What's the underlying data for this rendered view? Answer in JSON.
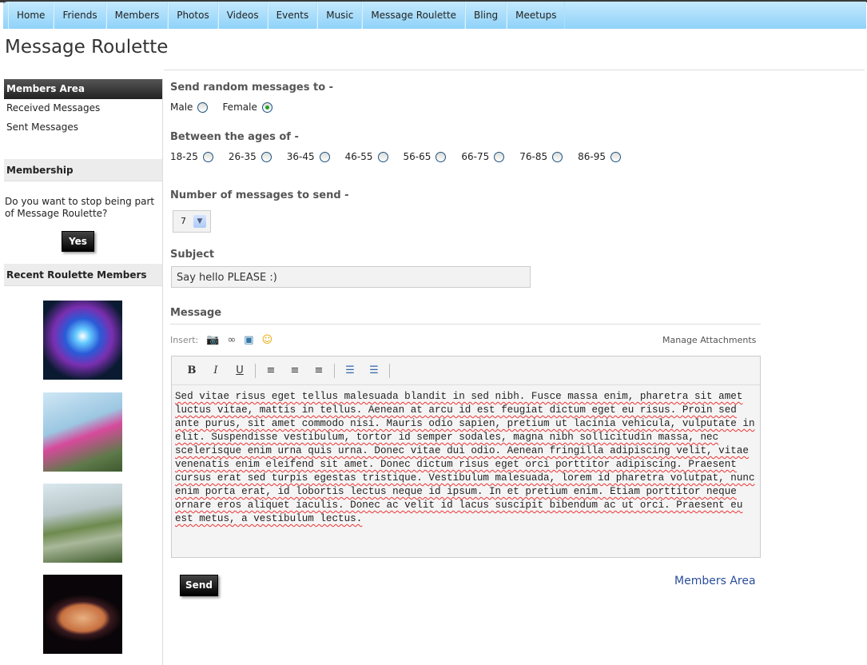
{
  "nav": {
    "items": [
      "Home",
      "Friends",
      "Members",
      "Photos",
      "Videos",
      "Events",
      "Music",
      "Message Roulette",
      "Bling",
      "Meetups"
    ]
  },
  "page_title": "Message Roulette",
  "sidebar": {
    "members_area": {
      "title": "Members Area",
      "links": [
        "Received Messages",
        "Sent Messages"
      ]
    },
    "membership": {
      "title": "Membership",
      "question": "Do you want to stop being part of Message Roulette?",
      "yes_label": "Yes"
    },
    "recent": {
      "title": "Recent Roulette Members",
      "thumbnails": [
        "fractal-image",
        "skydiving-couple",
        "modern-building",
        "planet-saturn"
      ]
    }
  },
  "form": {
    "send_to_label": "Send random messages to -",
    "gender": [
      {
        "label": "Male",
        "checked": false
      },
      {
        "label": "Female",
        "checked": true
      }
    ],
    "ages_label": "Between the ages of -",
    "ages": [
      {
        "label": "18-25",
        "checked": false
      },
      {
        "label": "26-35",
        "checked": false
      },
      {
        "label": "36-45",
        "checked": false
      },
      {
        "label": "46-55",
        "checked": false
      },
      {
        "label": "56-65",
        "checked": false
      },
      {
        "label": "66-75",
        "checked": false
      },
      {
        "label": "76-85",
        "checked": false
      },
      {
        "label": "86-95",
        "checked": false
      }
    ],
    "count_label": "Number of messages to send -",
    "count_value": "7",
    "subject_label": "Subject",
    "subject_value": "Say hello PLEASE :)",
    "message_label": "Message",
    "insert_label": "Insert:",
    "insert_icons": [
      "camera-icon",
      "link-icon",
      "window-add-icon",
      "smiley-icon"
    ],
    "manage_attachments": "Manage Attachments",
    "toolbar": [
      "bold",
      "italic",
      "underline",
      "align-left",
      "align-center",
      "align-right",
      "bulleted-list",
      "numbered-list"
    ],
    "message_text": "Sed vitae risus eget tellus malesuada blandit in sed nibh. Fusce massa enim, pharetra sit amet luctus vitae, mattis in tellus. Aenean at arcu id est feugiat dictum eget eu risus. Proin sed ante purus, sit amet commodo nisi. Mauris odio sapien, pretium ut lacinia vehicula, vulputate in elit. Suspendisse vestibulum, tortor id semper sodales, magna nibh sollicitudin massa, nec scelerisque enim urna quis urna. Donec vitae dui odio. Aenean fringilla adipiscing velit, vitae venenatis enim eleifend sit amet. Donec dictum risus eget orci porttitor adipiscing. Praesent cursus erat sed turpis egestas tristique. Vestibulum malesuada, lorem id pharetra volutpat, nunc enim porta erat, id lobortis lectus neque id ipsum. In et pretium enim. Etiam porttitor neque ornare eros aliquet iaculis. Donec ac velit id lacus suscipit bibendum ac ut orci. Praesent eu est metus, a vestibulum lectus.",
    "send_label": "Send",
    "members_area_link": "Members Area"
  }
}
